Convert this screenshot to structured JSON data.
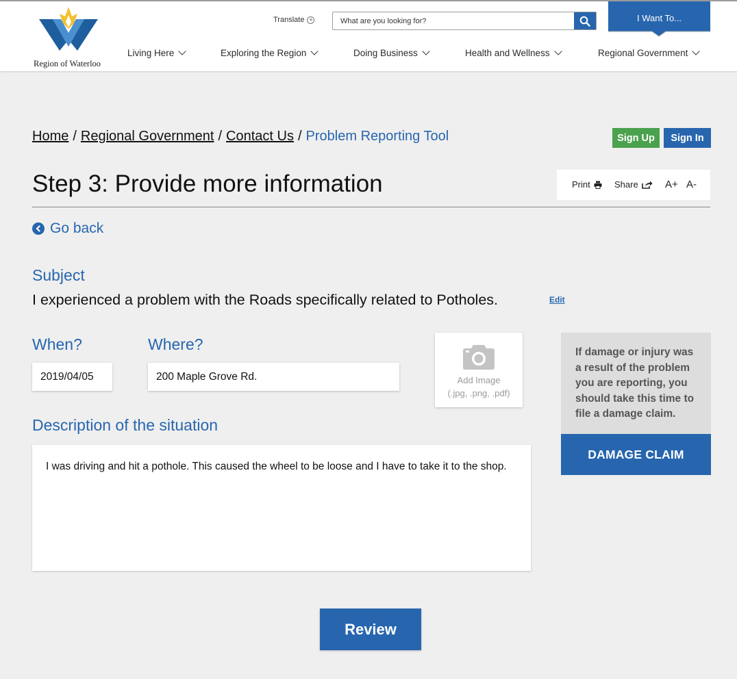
{
  "header": {
    "logo_text": "Region of Waterloo",
    "translate_label": "Translate",
    "translate_symbol": "+",
    "search_placeholder": "What are you looking for?",
    "iwant_label": "I Want To...",
    "nav": [
      {
        "label": "Living Here"
      },
      {
        "label": "Exploring the Region"
      },
      {
        "label": "Doing Business"
      },
      {
        "label": "Health and Wellness"
      },
      {
        "label": "Regional Government"
      }
    ]
  },
  "breadcrumb": {
    "items": [
      "Home",
      "Regional Government",
      "Contact Us"
    ],
    "separator": "/",
    "current": "Problem Reporting Tool"
  },
  "auth": {
    "signup_label": "Sign Up",
    "signin_label": "Sign In"
  },
  "page": {
    "title": "Step 3: Provide more information"
  },
  "tools": {
    "print_label": "Print",
    "share_label": "Share",
    "font_increase": "A+",
    "font_decrease": "A-"
  },
  "go_back_label": "Go back",
  "subject": {
    "label": "Subject",
    "text": "I experienced a problem with the Roads specifically related to Potholes.",
    "edit_label": "Edit"
  },
  "when": {
    "label": "When?",
    "value": "2019/04/05"
  },
  "where": {
    "label": "Where?",
    "value": "200 Maple Grove Rd."
  },
  "add_image": {
    "label": "Add Image",
    "formats": "(.jpg, .png, .pdf)"
  },
  "description": {
    "label": "Description of the situation",
    "value": "I was driving and hit a pothole. This caused the wheel to be loose and I have to take it to the shop."
  },
  "damage": {
    "text": "If damage or injury was a result of the problem you are reporting, you should take this time to file a damage claim.",
    "button_label": "DAMAGE CLAIM"
  },
  "review_label": "Review",
  "colors": {
    "brand_blue": "#2766ae",
    "signup_green": "#4aa24e",
    "page_bg": "#efefef",
    "damage_panel": "#dddddd"
  }
}
